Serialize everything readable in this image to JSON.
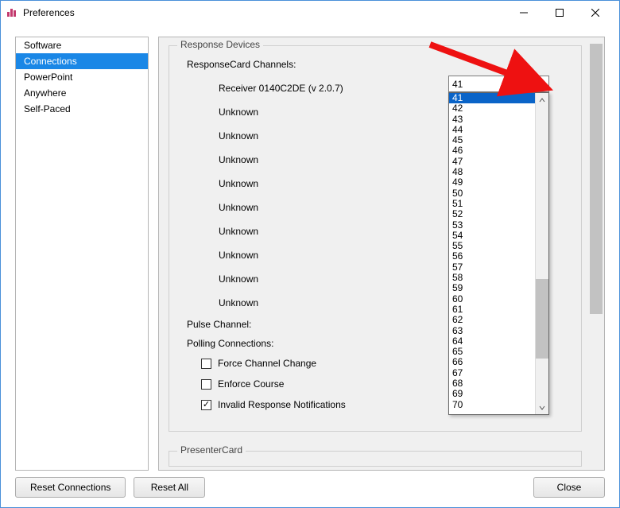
{
  "window": {
    "title": "Preferences"
  },
  "sidebar": {
    "items": [
      {
        "label": "Software"
      },
      {
        "label": "Connections"
      },
      {
        "label": "PowerPoint"
      },
      {
        "label": "Anywhere"
      },
      {
        "label": "Self-Paced"
      }
    ],
    "selected_index": 1
  },
  "response_devices": {
    "legend": "Response Devices",
    "channels_label": "ResponseCard Channels:",
    "rows": [
      {
        "label": "Receiver 0140C2DE (v 2.0.7)",
        "value": "41"
      },
      {
        "label": "Unknown"
      },
      {
        "label": "Unknown"
      },
      {
        "label": "Unknown"
      },
      {
        "label": "Unknown"
      },
      {
        "label": "Unknown"
      },
      {
        "label": "Unknown"
      },
      {
        "label": "Unknown"
      },
      {
        "label": "Unknown"
      },
      {
        "label": "Unknown"
      }
    ],
    "pulse_label": "Pulse Channel:",
    "polling_label": "Polling Connections:",
    "checkboxes": [
      {
        "label": "Force Channel Change",
        "checked": false
      },
      {
        "label": "Enforce Course",
        "checked": false
      },
      {
        "label": "Invalid Response Notifications",
        "checked": true
      }
    ]
  },
  "dropdown": {
    "selected": "41",
    "options": [
      "41",
      "42",
      "43",
      "44",
      "45",
      "46",
      "47",
      "48",
      "49",
      "50",
      "51",
      "52",
      "53",
      "54",
      "55",
      "56",
      "57",
      "58",
      "59",
      "60",
      "61",
      "62",
      "63",
      "64",
      "65",
      "66",
      "67",
      "68",
      "69",
      "70"
    ]
  },
  "presenter_card": {
    "legend": "PresenterCard"
  },
  "buttons": {
    "reset_connections": "Reset Connections",
    "reset_all": "Reset All",
    "close": "Close"
  }
}
